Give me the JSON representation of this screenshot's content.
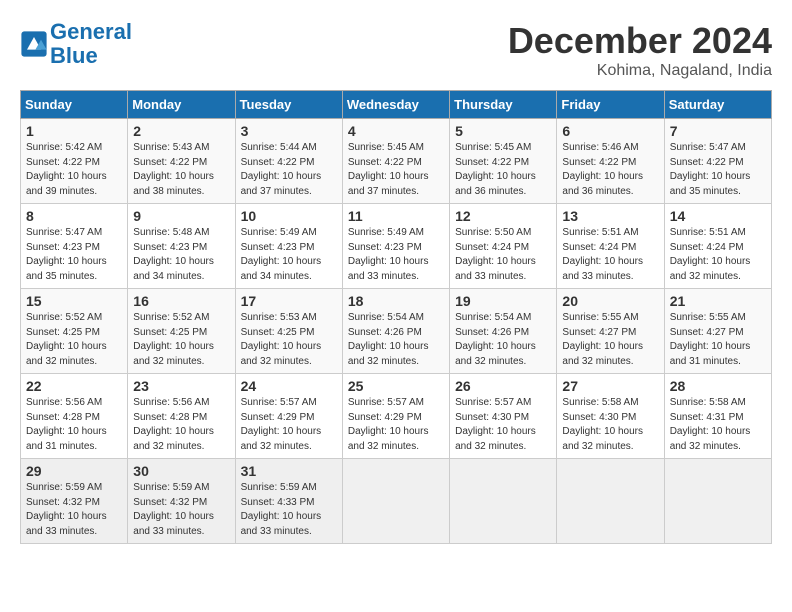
{
  "header": {
    "logo_line1": "General",
    "logo_line2": "Blue",
    "month": "December 2024",
    "location": "Kohima, Nagaland, India"
  },
  "columns": [
    "Sunday",
    "Monday",
    "Tuesday",
    "Wednesday",
    "Thursday",
    "Friday",
    "Saturday"
  ],
  "weeks": [
    [
      {
        "day": "1",
        "info": "Sunrise: 5:42 AM\nSunset: 4:22 PM\nDaylight: 10 hours\nand 39 minutes."
      },
      {
        "day": "2",
        "info": "Sunrise: 5:43 AM\nSunset: 4:22 PM\nDaylight: 10 hours\nand 38 minutes."
      },
      {
        "day": "3",
        "info": "Sunrise: 5:44 AM\nSunset: 4:22 PM\nDaylight: 10 hours\nand 37 minutes."
      },
      {
        "day": "4",
        "info": "Sunrise: 5:45 AM\nSunset: 4:22 PM\nDaylight: 10 hours\nand 37 minutes."
      },
      {
        "day": "5",
        "info": "Sunrise: 5:45 AM\nSunset: 4:22 PM\nDaylight: 10 hours\nand 36 minutes."
      },
      {
        "day": "6",
        "info": "Sunrise: 5:46 AM\nSunset: 4:22 PM\nDaylight: 10 hours\nand 36 minutes."
      },
      {
        "day": "7",
        "info": "Sunrise: 5:47 AM\nSunset: 4:22 PM\nDaylight: 10 hours\nand 35 minutes."
      }
    ],
    [
      {
        "day": "8",
        "info": "Sunrise: 5:47 AM\nSunset: 4:23 PM\nDaylight: 10 hours\nand 35 minutes."
      },
      {
        "day": "9",
        "info": "Sunrise: 5:48 AM\nSunset: 4:23 PM\nDaylight: 10 hours\nand 34 minutes."
      },
      {
        "day": "10",
        "info": "Sunrise: 5:49 AM\nSunset: 4:23 PM\nDaylight: 10 hours\nand 34 minutes."
      },
      {
        "day": "11",
        "info": "Sunrise: 5:49 AM\nSunset: 4:23 PM\nDaylight: 10 hours\nand 33 minutes."
      },
      {
        "day": "12",
        "info": "Sunrise: 5:50 AM\nSunset: 4:24 PM\nDaylight: 10 hours\nand 33 minutes."
      },
      {
        "day": "13",
        "info": "Sunrise: 5:51 AM\nSunset: 4:24 PM\nDaylight: 10 hours\nand 33 minutes."
      },
      {
        "day": "14",
        "info": "Sunrise: 5:51 AM\nSunset: 4:24 PM\nDaylight: 10 hours\nand 32 minutes."
      }
    ],
    [
      {
        "day": "15",
        "info": "Sunrise: 5:52 AM\nSunset: 4:25 PM\nDaylight: 10 hours\nand 32 minutes."
      },
      {
        "day": "16",
        "info": "Sunrise: 5:52 AM\nSunset: 4:25 PM\nDaylight: 10 hours\nand 32 minutes."
      },
      {
        "day": "17",
        "info": "Sunrise: 5:53 AM\nSunset: 4:25 PM\nDaylight: 10 hours\nand 32 minutes."
      },
      {
        "day": "18",
        "info": "Sunrise: 5:54 AM\nSunset: 4:26 PM\nDaylight: 10 hours\nand 32 minutes."
      },
      {
        "day": "19",
        "info": "Sunrise: 5:54 AM\nSunset: 4:26 PM\nDaylight: 10 hours\nand 32 minutes."
      },
      {
        "day": "20",
        "info": "Sunrise: 5:55 AM\nSunset: 4:27 PM\nDaylight: 10 hours\nand 32 minutes."
      },
      {
        "day": "21",
        "info": "Sunrise: 5:55 AM\nSunset: 4:27 PM\nDaylight: 10 hours\nand 31 minutes."
      }
    ],
    [
      {
        "day": "22",
        "info": "Sunrise: 5:56 AM\nSunset: 4:28 PM\nDaylight: 10 hours\nand 31 minutes."
      },
      {
        "day": "23",
        "info": "Sunrise: 5:56 AM\nSunset: 4:28 PM\nDaylight: 10 hours\nand 32 minutes."
      },
      {
        "day": "24",
        "info": "Sunrise: 5:57 AM\nSunset: 4:29 PM\nDaylight: 10 hours\nand 32 minutes."
      },
      {
        "day": "25",
        "info": "Sunrise: 5:57 AM\nSunset: 4:29 PM\nDaylight: 10 hours\nand 32 minutes."
      },
      {
        "day": "26",
        "info": "Sunrise: 5:57 AM\nSunset: 4:30 PM\nDaylight: 10 hours\nand 32 minutes."
      },
      {
        "day": "27",
        "info": "Sunrise: 5:58 AM\nSunset: 4:30 PM\nDaylight: 10 hours\nand 32 minutes."
      },
      {
        "day": "28",
        "info": "Sunrise: 5:58 AM\nSunset: 4:31 PM\nDaylight: 10 hours\nand 32 minutes."
      }
    ],
    [
      {
        "day": "29",
        "info": "Sunrise: 5:59 AM\nSunset: 4:32 PM\nDaylight: 10 hours\nand 33 minutes."
      },
      {
        "day": "30",
        "info": "Sunrise: 5:59 AM\nSunset: 4:32 PM\nDaylight: 10 hours\nand 33 minutes."
      },
      {
        "day": "31",
        "info": "Sunrise: 5:59 AM\nSunset: 4:33 PM\nDaylight: 10 hours\nand 33 minutes."
      },
      {
        "day": "",
        "info": ""
      },
      {
        "day": "",
        "info": ""
      },
      {
        "day": "",
        "info": ""
      },
      {
        "day": "",
        "info": ""
      }
    ]
  ]
}
